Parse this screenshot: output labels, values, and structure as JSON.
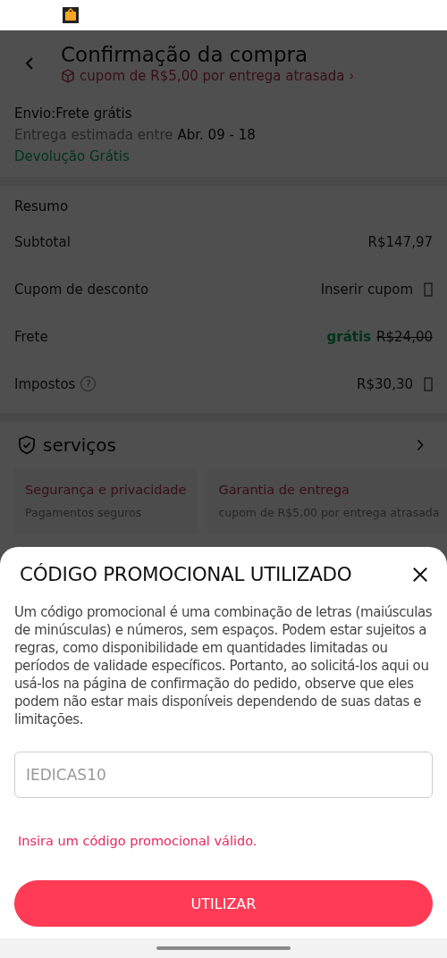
{
  "header": {
    "title": "Confirmação da compra",
    "subtitle": "cupom de R$5,00 por entrega atrasada ›"
  },
  "shipping": {
    "title": "Envio:Frete grátis",
    "estimate_label": "Entrega estimada entre",
    "estimate_dates": "Abr. 09 - 18",
    "returns": "Devolução Grátis"
  },
  "summary": {
    "title": "Resumo",
    "rows": [
      {
        "kind": "plain",
        "label": "Subtotal",
        "value": "R$147,97",
        "arrow": false
      },
      {
        "kind": "action",
        "label": "Cupom de desconto",
        "value": "Inserir cupom",
        "arrow": true
      },
      {
        "kind": "discount",
        "label": "Frete",
        "value": "grátis",
        "old_value": "R$24,00",
        "arrow": false
      },
      {
        "kind": "plain",
        "label": "Impostos",
        "help": "?",
        "value": "R$30,30",
        "arrow": true
      }
    ]
  },
  "services": {
    "title": "serviços",
    "cards": [
      {
        "title": "Segurança e privacidade",
        "subtitle": "Pagamentos seguros"
      },
      {
        "title": "Garantia de entrega",
        "subtitle": "cupom de R$5,00 por entrega atrasada"
      }
    ]
  },
  "dialog": {
    "title": "CÓDIGO PROMOCIONAL UTILIZADO",
    "text": "Um código promocional é uma combinação de letras (maiúsculas de minúsculas) e números, sem espaços. Podem estar sujeitos a regras, como disponibilidade em quantidades limitadas ou períodos de validade específicos. Portanto, ao solicitá-los aqui ou usá-los na página de confirmação do pedido, observe que eles podem não estar mais disponíveis dependendo de suas datas e limitações.",
    "code_field": {
      "value": "IEDICAS10"
    },
    "error": "Insira um código promocional válido.",
    "button": "UTILIZAR"
  }
}
